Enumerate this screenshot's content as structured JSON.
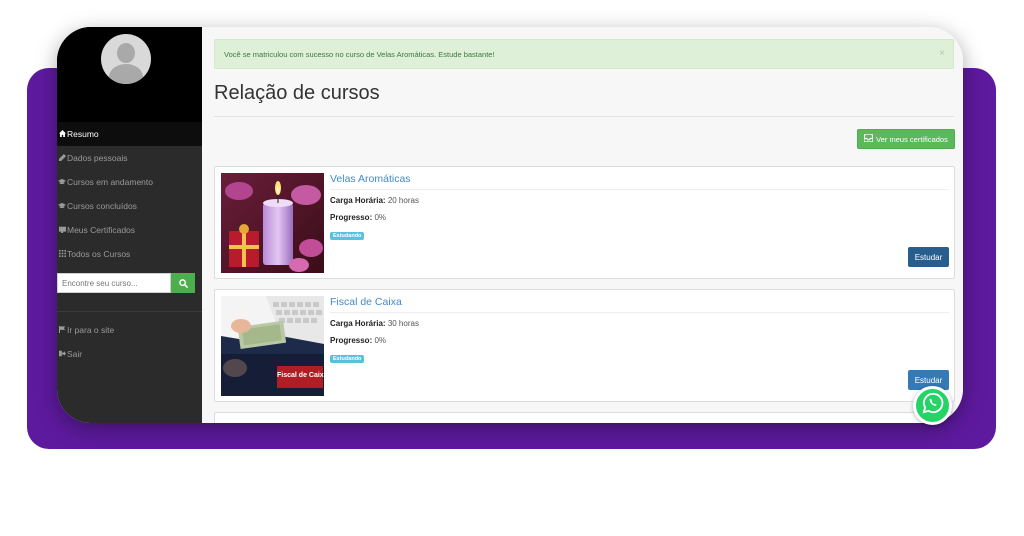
{
  "sidebar": {
    "items": [
      {
        "label": "Resumo",
        "icon": "home-icon",
        "active": true
      },
      {
        "label": "Dados pessoais",
        "icon": "pencil-icon",
        "active": false
      },
      {
        "label": "Cursos em andamento",
        "icon": "graduation-cap-icon",
        "active": false
      },
      {
        "label": "Cursos concluídos",
        "icon": "graduation-cap-icon",
        "active": false
      },
      {
        "label": "Meus Certificados",
        "icon": "certificate-icon",
        "active": false
      },
      {
        "label": "Todos os Cursos",
        "icon": "grid-icon",
        "active": false
      }
    ],
    "search": {
      "placeholder": "Encontre seu curso..."
    },
    "links": [
      {
        "label": "Ir para o site",
        "icon": "flag-icon"
      },
      {
        "label": "Sair",
        "icon": "sign-out-icon"
      }
    ]
  },
  "alert": {
    "message": "Você se matriculou com sucesso no curso de Velas Aromáticas. Estude bastante!",
    "close": "×"
  },
  "page": {
    "title": "Relação de cursos"
  },
  "actions": {
    "certificates_label": "Ver meus certificados"
  },
  "courses": [
    {
      "title": "Velas Aromáticas",
      "hours_label": "Carga Horária:",
      "hours_value": "20 horas",
      "progress_label": "Progresso:",
      "progress_value": "0%",
      "status": "Estudando",
      "action": "Estudar",
      "image": "candle-orchid-photo"
    },
    {
      "title": "Fiscal de Caixa",
      "hours_label": "Carga Horária:",
      "hours_value": "30 horas",
      "progress_label": "Progresso:",
      "progress_value": "0%",
      "status": "Estudando",
      "action": "Estudar",
      "image": "cashier-keyboard-photo",
      "image_caption": "Fiscal de Caixa"
    }
  ],
  "colors": {
    "accent_purple": "#5e1a9f",
    "success": "#5cb85c",
    "link": "#428bca",
    "info_badge": "#5bc0de",
    "study_btn_dark": "#285e8e",
    "study_btn": "#337ab7",
    "whatsapp": "#25d366"
  },
  "widgets": {
    "chat_icon": "whatsapp-icon"
  }
}
